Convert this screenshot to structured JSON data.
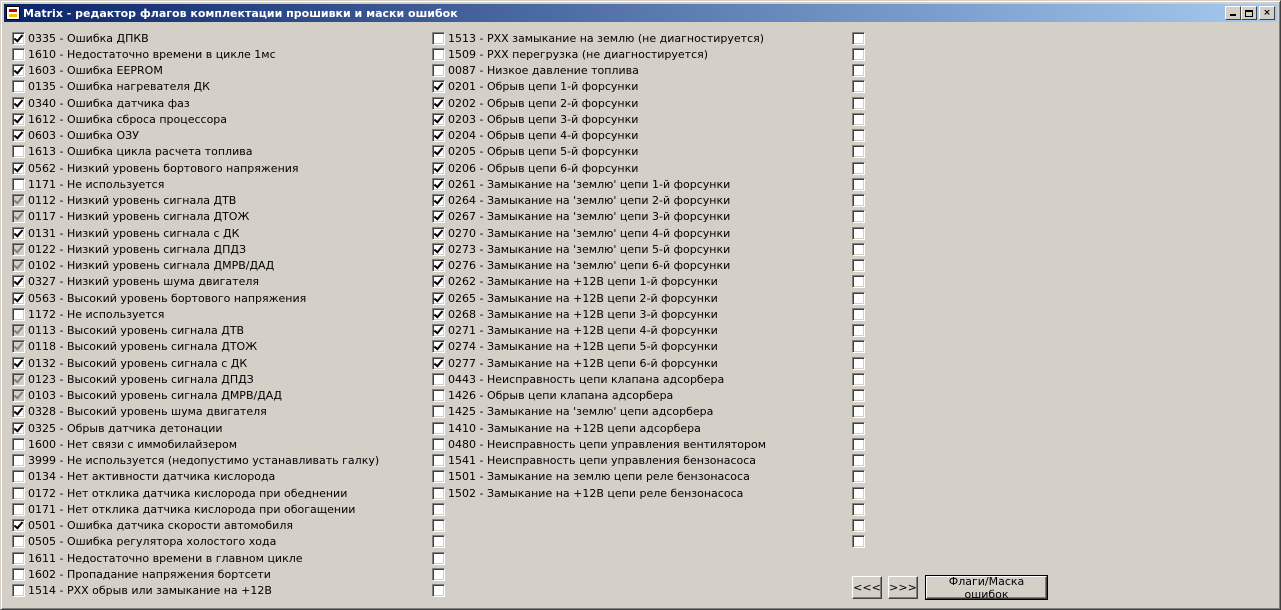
{
  "window": {
    "title": "Matrix - редактор флагов комплектации прошивки и маски ошибок",
    "controls": {
      "minimize": "_",
      "maximize": "□",
      "close": "×"
    }
  },
  "columns": [
    [
      {
        "label": "0335 - Ошибка ДПКВ",
        "checked": true,
        "grey": false
      },
      {
        "label": "1610 - Недостаточно времени в цикле 1мс",
        "checked": false,
        "grey": false
      },
      {
        "label": "1603 - Ошибка EEPROM",
        "checked": true,
        "grey": false
      },
      {
        "label": "0135 - Ошибка нагревателя ДК",
        "checked": false,
        "grey": false
      },
      {
        "label": "0340 - Ошибка датчика фаз",
        "checked": true,
        "grey": false
      },
      {
        "label": "1612 - Ошибка сброса процессора",
        "checked": true,
        "grey": false
      },
      {
        "label": "0603 - Ошибка ОЗУ",
        "checked": true,
        "grey": false
      },
      {
        "label": "1613 - Ошибка цикла расчета топлива",
        "checked": false,
        "grey": false
      },
      {
        "label": "0562 - Низкий уровень бортового напряжения",
        "checked": true,
        "grey": false
      },
      {
        "label": "1171 - Не используется",
        "checked": false,
        "grey": false
      },
      {
        "label": "0112 - Низкий уровень сигнала ДТВ",
        "checked": true,
        "grey": true
      },
      {
        "label": "0117 - Низкий уровень сигнала ДТОЖ",
        "checked": true,
        "grey": true
      },
      {
        "label": "0131 - Низкий уровень сигнала с ДК",
        "checked": true,
        "grey": false
      },
      {
        "label": "0122 - Низкий уровень сигнала ДПДЗ",
        "checked": true,
        "grey": true
      },
      {
        "label": "0102 - Низкий уровень сигнала ДМРВ/ДАД",
        "checked": true,
        "grey": true
      },
      {
        "label": "0327 - Низкий уровень шума двигателя",
        "checked": true,
        "grey": false
      },
      {
        "label": "0563 - Высокий уровень бортового напряжения",
        "checked": true,
        "grey": false
      },
      {
        "label": "1172 - Не используется",
        "checked": false,
        "grey": false
      },
      {
        "label": "0113 - Высокий уровень сигнала ДТВ",
        "checked": true,
        "grey": true
      },
      {
        "label": "0118 - Высокий уровень сигнала ДТОЖ",
        "checked": true,
        "grey": true
      },
      {
        "label": "0132 - Высокий уровень сигнала с ДК",
        "checked": true,
        "grey": false
      },
      {
        "label": "0123 - Высокий уровень сигнала ДПДЗ",
        "checked": true,
        "grey": true
      },
      {
        "label": "0103 - Высокий уровень сигнала ДМРВ/ДАД",
        "checked": true,
        "grey": true
      },
      {
        "label": "0328 - Высокий уровень шума двигателя",
        "checked": true,
        "grey": false
      },
      {
        "label": "0325 - Обрыв датчика детонации",
        "checked": true,
        "grey": false
      },
      {
        "label": "1600 - Нет связи с иммобилайзером",
        "checked": false,
        "grey": false
      },
      {
        "label": "3999 - Не используется (недопустимо устанавливать галку)",
        "checked": false,
        "grey": false
      },
      {
        "label": "0134 - Нет активности датчика кислорода",
        "checked": false,
        "grey": false
      },
      {
        "label": "0172 - Нет отклика датчика кислорода при обеднении",
        "checked": false,
        "grey": false
      },
      {
        "label": "0171 - Нет отклика датчика кислорода при обогащении",
        "checked": false,
        "grey": false
      },
      {
        "label": "0501 - Ошибка датчика скорости автомобиля",
        "checked": true,
        "grey": false
      },
      {
        "label": "0505 - Ошибка регулятора холостого хода",
        "checked": false,
        "grey": false
      },
      {
        "label": "1611 - Недостаточно времени в главном цикле",
        "checked": false,
        "grey": false
      },
      {
        "label": "1602 - Пропадание напряжения бортсети",
        "checked": false,
        "grey": false
      },
      {
        "label": "1514 - РХХ обрыв или замыкание на +12В",
        "checked": false,
        "grey": false
      }
    ],
    [
      {
        "label": "1513 - РХХ замыкание на землю (не диагностируется)",
        "checked": false,
        "grey": false
      },
      {
        "label": "1509 - РХХ перегрузка (не диагностируется)",
        "checked": false,
        "grey": false
      },
      {
        "label": "0087 - Низкое давление топлива",
        "checked": false,
        "grey": false
      },
      {
        "label": "0201 - Обрыв цепи 1-й форсунки",
        "checked": true,
        "grey": false
      },
      {
        "label": "0202 - Обрыв цепи 2-й форсунки",
        "checked": true,
        "grey": false
      },
      {
        "label": "0203 - Обрыв цепи 3-й форсунки",
        "checked": true,
        "grey": false
      },
      {
        "label": "0204 - Обрыв цепи 4-й форсунки",
        "checked": true,
        "grey": false
      },
      {
        "label": "0205 - Обрыв цепи 5-й форсунки",
        "checked": true,
        "grey": false
      },
      {
        "label": "0206 - Обрыв цепи 6-й форсунки",
        "checked": true,
        "grey": false
      },
      {
        "label": "0261 - Замыкание на 'землю' цепи 1-й форсунки",
        "checked": true,
        "grey": false
      },
      {
        "label": "0264 - Замыкание на 'землю' цепи 2-й форсунки",
        "checked": true,
        "grey": false
      },
      {
        "label": "0267 - Замыкание на 'землю' цепи 3-й форсунки",
        "checked": true,
        "grey": false
      },
      {
        "label": "0270 - Замыкание на 'землю' цепи 4-й форсунки",
        "checked": true,
        "grey": false
      },
      {
        "label": "0273 - Замыкание на 'землю' цепи 5-й форсунки",
        "checked": true,
        "grey": false
      },
      {
        "label": "0276 - Замыкание на 'землю' цепи 6-й форсунки",
        "checked": true,
        "grey": false
      },
      {
        "label": "0262 - Замыкание на +12В цепи 1-й форсунки",
        "checked": true,
        "grey": false
      },
      {
        "label": "0265 - Замыкание на +12В цепи 2-й форсунки",
        "checked": true,
        "grey": false
      },
      {
        "label": "0268 - Замыкание на +12В цепи 3-й форсунки",
        "checked": true,
        "grey": false
      },
      {
        "label": "0271 - Замыкание на +12В цепи 4-й форсунки",
        "checked": true,
        "grey": false
      },
      {
        "label": "0274 - Замыкание на +12В цепи 5-й форсунки",
        "checked": true,
        "grey": false
      },
      {
        "label": "0277 - Замыкание на +12В цепи 6-й форсунки",
        "checked": true,
        "grey": false
      },
      {
        "label": "0443 - Неисправность цепи клапана адсорбера",
        "checked": false,
        "grey": false
      },
      {
        "label": "1426 - Обрыв цепи клапана адсорбера",
        "checked": false,
        "grey": false
      },
      {
        "label": "1425 - Замыкание на 'землю' цепи адсорбера",
        "checked": false,
        "grey": false
      },
      {
        "label": "1410 - Замыкание на +12В цепи адсорбера",
        "checked": false,
        "grey": false
      },
      {
        "label": "0480 - Неисправность цепи управления вентилятором",
        "checked": false,
        "grey": false
      },
      {
        "label": "1541 - Неисправность цепи управления бензонасоса",
        "checked": false,
        "grey": false
      },
      {
        "label": "1501 - Замыкание на землю цепи реле бензонасоса",
        "checked": false,
        "grey": false
      },
      {
        "label": "1502 - Замыкание на +12В цепи реле бензонасоса",
        "checked": false,
        "grey": false
      },
      {
        "label": "",
        "checked": false,
        "grey": false
      },
      {
        "label": "",
        "checked": false,
        "grey": false
      },
      {
        "label": "",
        "checked": false,
        "grey": false
      },
      {
        "label": "",
        "checked": false,
        "grey": false
      },
      {
        "label": "",
        "checked": false,
        "grey": false
      },
      {
        "label": "",
        "checked": false,
        "grey": false
      }
    ],
    [
      {
        "label": "",
        "checked": false,
        "grey": false
      },
      {
        "label": "",
        "checked": false,
        "grey": false
      },
      {
        "label": "",
        "checked": false,
        "grey": false
      },
      {
        "label": "",
        "checked": false,
        "grey": false
      },
      {
        "label": "",
        "checked": false,
        "grey": false
      },
      {
        "label": "",
        "checked": false,
        "grey": false
      },
      {
        "label": "",
        "checked": false,
        "grey": false
      },
      {
        "label": "",
        "checked": false,
        "grey": false
      },
      {
        "label": "",
        "checked": false,
        "grey": false
      },
      {
        "label": "",
        "checked": false,
        "grey": false
      },
      {
        "label": "",
        "checked": false,
        "grey": false
      },
      {
        "label": "",
        "checked": false,
        "grey": false
      },
      {
        "label": "",
        "checked": false,
        "grey": false
      },
      {
        "label": "",
        "checked": false,
        "grey": false
      },
      {
        "label": "",
        "checked": false,
        "grey": false
      },
      {
        "label": "",
        "checked": false,
        "grey": false
      },
      {
        "label": "",
        "checked": false,
        "grey": false
      },
      {
        "label": "",
        "checked": false,
        "grey": false
      },
      {
        "label": "",
        "checked": false,
        "grey": false
      },
      {
        "label": "",
        "checked": false,
        "grey": false
      },
      {
        "label": "",
        "checked": false,
        "grey": false
      },
      {
        "label": "",
        "checked": false,
        "grey": false
      },
      {
        "label": "",
        "checked": false,
        "grey": false
      },
      {
        "label": "",
        "checked": false,
        "grey": false
      },
      {
        "label": "",
        "checked": false,
        "grey": false
      },
      {
        "label": "",
        "checked": false,
        "grey": false
      },
      {
        "label": "",
        "checked": false,
        "grey": false
      },
      {
        "label": "",
        "checked": false,
        "grey": false
      },
      {
        "label": "",
        "checked": false,
        "grey": false
      },
      {
        "label": "",
        "checked": false,
        "grey": false
      },
      {
        "label": "",
        "checked": false,
        "grey": false
      },
      {
        "label": "",
        "checked": false,
        "grey": false
      }
    ]
  ],
  "buttons": {
    "prev": "<<<",
    "next": ">>>",
    "flags": "Флаги/Маска ошибок"
  }
}
